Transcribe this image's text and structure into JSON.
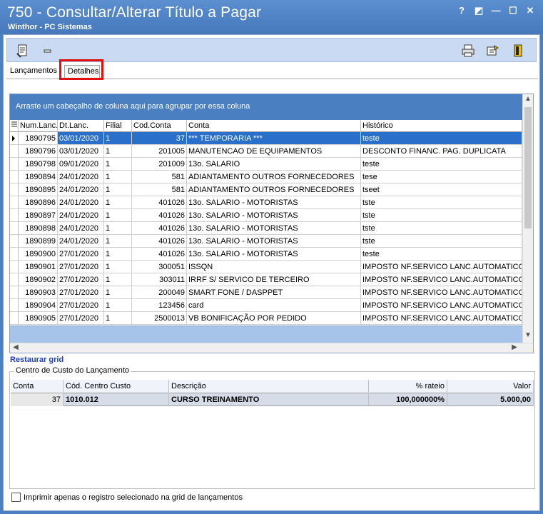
{
  "window": {
    "title": "750 - Consultar/Alterar Título a Pagar",
    "subtitle": "Winthor - PC Sistemas",
    "buttons": [
      "?",
      "◩",
      "—",
      "☐",
      "✕"
    ]
  },
  "tabs": [
    {
      "label": "Lançamentos"
    },
    {
      "label": "Detalhes"
    }
  ],
  "grid": {
    "group_hint": "Arraste um cabeçalho de coluna aqui para agrupar por essa coluna",
    "columns": [
      "Num.Lanc.",
      "Dt.Lanc.",
      "Filial",
      "Cod.Conta",
      "Conta",
      "Histórico"
    ],
    "rows": [
      [
        "1890795",
        "03/01/2020",
        "1",
        "37",
        "*** TEMPORARIA ***",
        "teste"
      ],
      [
        "1890796",
        "03/01/2020",
        "1",
        "201005",
        "MANUTENCAO DE EQUIPAMENTOS",
        "DESCONTO FINANC. PAG. DUPLICATA"
      ],
      [
        "1890798",
        "09/01/2020",
        "1",
        "201009",
        "13o. SALARIO",
        "teste"
      ],
      [
        "1890894",
        "24/01/2020",
        "1",
        "581",
        "ADIANTAMENTO OUTROS FORNECEDORES",
        "tese"
      ],
      [
        "1890895",
        "24/01/2020",
        "1",
        "581",
        "ADIANTAMENTO OUTROS FORNECEDORES",
        "tseet"
      ],
      [
        "1890896",
        "24/01/2020",
        "1",
        "401026",
        "13o. SALARIO - MOTORISTAS",
        "tste"
      ],
      [
        "1890897",
        "24/01/2020",
        "1",
        "401026",
        "13o. SALARIO - MOTORISTAS",
        "tste"
      ],
      [
        "1890898",
        "24/01/2020",
        "1",
        "401026",
        "13o. SALARIO - MOTORISTAS",
        "tste"
      ],
      [
        "1890899",
        "24/01/2020",
        "1",
        "401026",
        "13o. SALARIO - MOTORISTAS",
        "tste"
      ],
      [
        "1890900",
        "27/01/2020",
        "1",
        "401026",
        "13o. SALARIO - MOTORISTAS",
        "teste"
      ],
      [
        "1890901",
        "27/01/2020",
        "1",
        "300051",
        "ISSQN",
        "IMPOSTO NF.SERVICO LANC.AUTOMATICO"
      ],
      [
        "1890902",
        "27/01/2020",
        "1",
        "303011",
        "IRRF S/ SERVICO DE TERCEIRO",
        "IMPOSTO NF.SERVICO LANC.AUTOMATICO"
      ],
      [
        "1890903",
        "27/01/2020",
        "1",
        "200049",
        "SMART FONE / DASPPET",
        "IMPOSTO NF.SERVICO LANC.AUTOMATICO"
      ],
      [
        "1890904",
        "27/01/2020",
        "1",
        "123456",
        "card",
        "IMPOSTO NF.SERVICO LANC.AUTOMATICO"
      ],
      [
        "1890905",
        "27/01/2020",
        "1",
        "2500013",
        "VB BONIFICAÇÃO POR PEDIDO",
        "IMPOSTO NF.SERVICO LANC.AUTOMATICO"
      ]
    ]
  },
  "restore_label": "Restaurar grid",
  "cost_center": {
    "legend": "Centro de Custo do Lançamento",
    "columns": [
      "Conta",
      "Cód. Centro Custo",
      "Descrição",
      "% rateio",
      "Valor"
    ],
    "rows": [
      [
        "37",
        "1010.012",
        "CURSO TREINAMENTO",
        "100,000000%",
        "5.000,00"
      ]
    ]
  },
  "checkbox_label": "Imprimir apenas o registro selecionado na grid de lançamentos",
  "colors": {
    "accent": "#4a7fc1",
    "selection": "#2a6fc9",
    "highlight": "#e01010"
  }
}
